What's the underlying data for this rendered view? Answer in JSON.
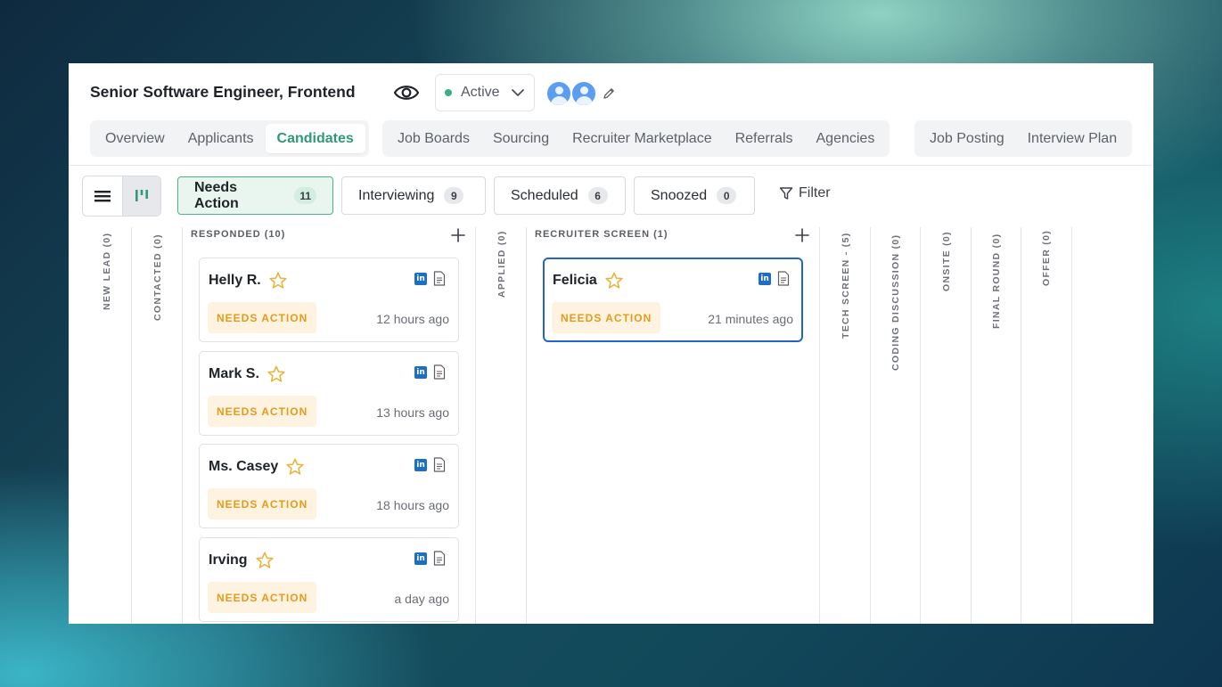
{
  "header": {
    "title": "Senior Software Engineer, Frontend",
    "status_label": "Active",
    "status_color": "#3fae84"
  },
  "tabs": {
    "group1": [
      {
        "label": "Overview",
        "active": false
      },
      {
        "label": "Applicants",
        "active": false
      },
      {
        "label": "Candidates",
        "active": true
      }
    ],
    "group2": [
      {
        "label": "Job Boards"
      },
      {
        "label": "Sourcing"
      },
      {
        "label": "Recruiter Marketplace"
      },
      {
        "label": "Referrals"
      },
      {
        "label": "Agencies"
      }
    ],
    "group3": [
      {
        "label": "Job Posting"
      },
      {
        "label": "Interview Plan"
      }
    ]
  },
  "filters": {
    "items": [
      {
        "label": "Needs Action",
        "count": "11",
        "selected": true
      },
      {
        "label": "Interviewing",
        "count": "9",
        "selected": false
      },
      {
        "label": "Scheduled",
        "count": "6",
        "selected": false
      },
      {
        "label": "Snoozed",
        "count": "0",
        "selected": false
      }
    ],
    "filter_label": "Filter"
  },
  "stages": {
    "new_lead": "NEW LEAD (0)",
    "contacted": "CONTACTED (0)",
    "responded": "RESPONDED (10)",
    "applied": "APPLIED (0)",
    "recruiter_screen": "RECRUITER SCREEN (1)",
    "tech_screen": "TECH SCREEN - (5)",
    "coding_discussion": "CODING DISCUSSION (0)",
    "onsite": "ONSITE (0)",
    "final_round": "FINAL ROUND (0)",
    "offer": "OFFER (0)"
  },
  "responded_cards": [
    {
      "name": "Helly R.",
      "badge": "NEEDS ACTION",
      "time": "12 hours ago"
    },
    {
      "name": "Mark S.",
      "badge": "NEEDS ACTION",
      "time": "13 hours ago"
    },
    {
      "name": "Ms. Casey",
      "badge": "NEEDS ACTION",
      "time": "18 hours ago"
    },
    {
      "name": "Irving",
      "badge": "NEEDS ACTION",
      "time": "a day ago"
    }
  ],
  "recruiter_screen_cards": [
    {
      "name": "Felicia",
      "badge": "NEEDS ACTION",
      "time": "21 minutes ago"
    }
  ],
  "colors": {
    "accent": "#2f9a73",
    "badge_text": "#e39b1c",
    "badge_bg": "#fef3e0",
    "focus_border": "#2166c5",
    "linkedin": "#1d6fc4",
    "star": "#e7b43a"
  },
  "icons": {
    "linkedin": "in"
  }
}
